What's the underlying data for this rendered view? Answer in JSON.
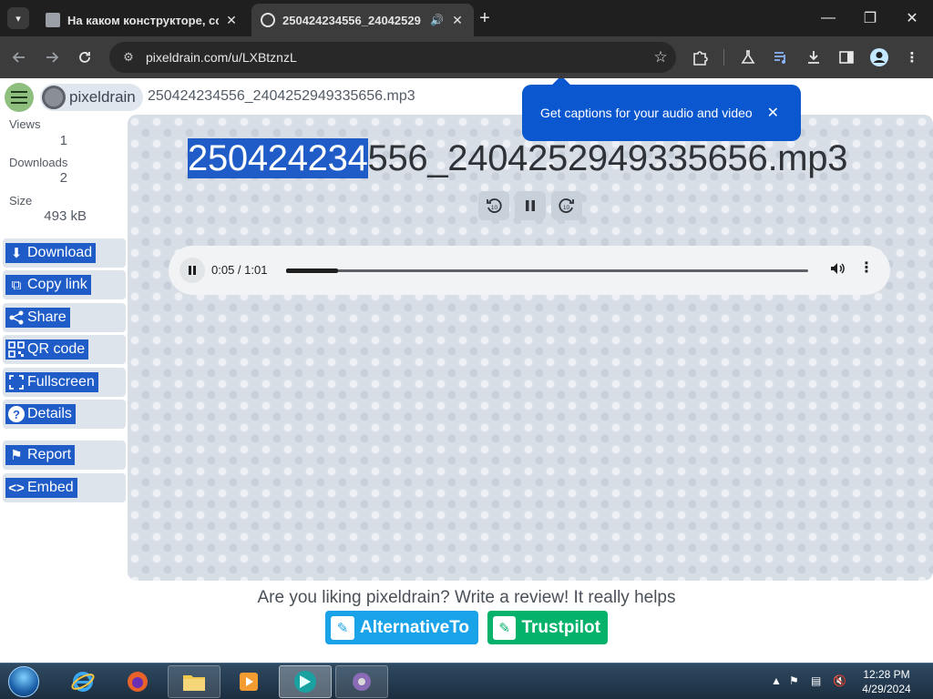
{
  "browser": {
    "tabs": [
      {
        "title": "На каком конструкторе, созд",
        "active": false
      },
      {
        "title": "250424234556_24042529",
        "active": true,
        "audio": true
      }
    ],
    "url": "pixeldrain.com/u/LXBtznzL",
    "icons": {
      "back": "arrow-left-icon",
      "forward": "arrow-right-icon",
      "reload": "reload-icon",
      "site_info": "tune-icon",
      "bookmark": "star-icon",
      "extensions": "puzzle-icon",
      "labs": "flask-icon",
      "media": "media-control-icon",
      "download": "download-icon",
      "sidepanel": "side-panel-icon",
      "profile": "profile-icon",
      "menu": "kebab-menu-icon"
    }
  },
  "captions_promo": {
    "text": "Get captions for your audio and video"
  },
  "header": {
    "brand": "pixeldrain",
    "filename": "250424234556_2404252949335656.mp3"
  },
  "stats": {
    "views_label": "Views",
    "views": "1",
    "downloads_label": "Downloads",
    "downloads": "2",
    "size_label": "Size",
    "size": "493 kB"
  },
  "actions": [
    {
      "label": "Download",
      "icon": "download-icon"
    },
    {
      "label": "Copy link",
      "icon": "copy-icon"
    },
    {
      "label": "Share",
      "icon": "share-icon"
    },
    {
      "label": "QR code",
      "icon": "qr-code-icon"
    },
    {
      "label": "Fullscreen",
      "icon": "fullscreen-icon"
    },
    {
      "label": "Details",
      "icon": "help-icon"
    },
    {
      "label": "Report",
      "icon": "flag-icon"
    },
    {
      "label": "Embed",
      "icon": "code-icon"
    }
  ],
  "viewer": {
    "title_selected": "250424234",
    "title_rest": "556_2404252949335656.mp3",
    "player": {
      "time": "0:05 / 1:01",
      "progress": 0.1
    }
  },
  "review": {
    "text": "Are you liking pixeldrain? Write a review! It really helps",
    "alternativeto": "AlternativeTo",
    "trustpilot": "Trustpilot",
    "colors": {
      "alternativeto": "#1aa3e8",
      "trustpilot": "#04b26b"
    }
  },
  "taskbar": {
    "time": "12:28 PM",
    "date": "4/29/2024"
  }
}
